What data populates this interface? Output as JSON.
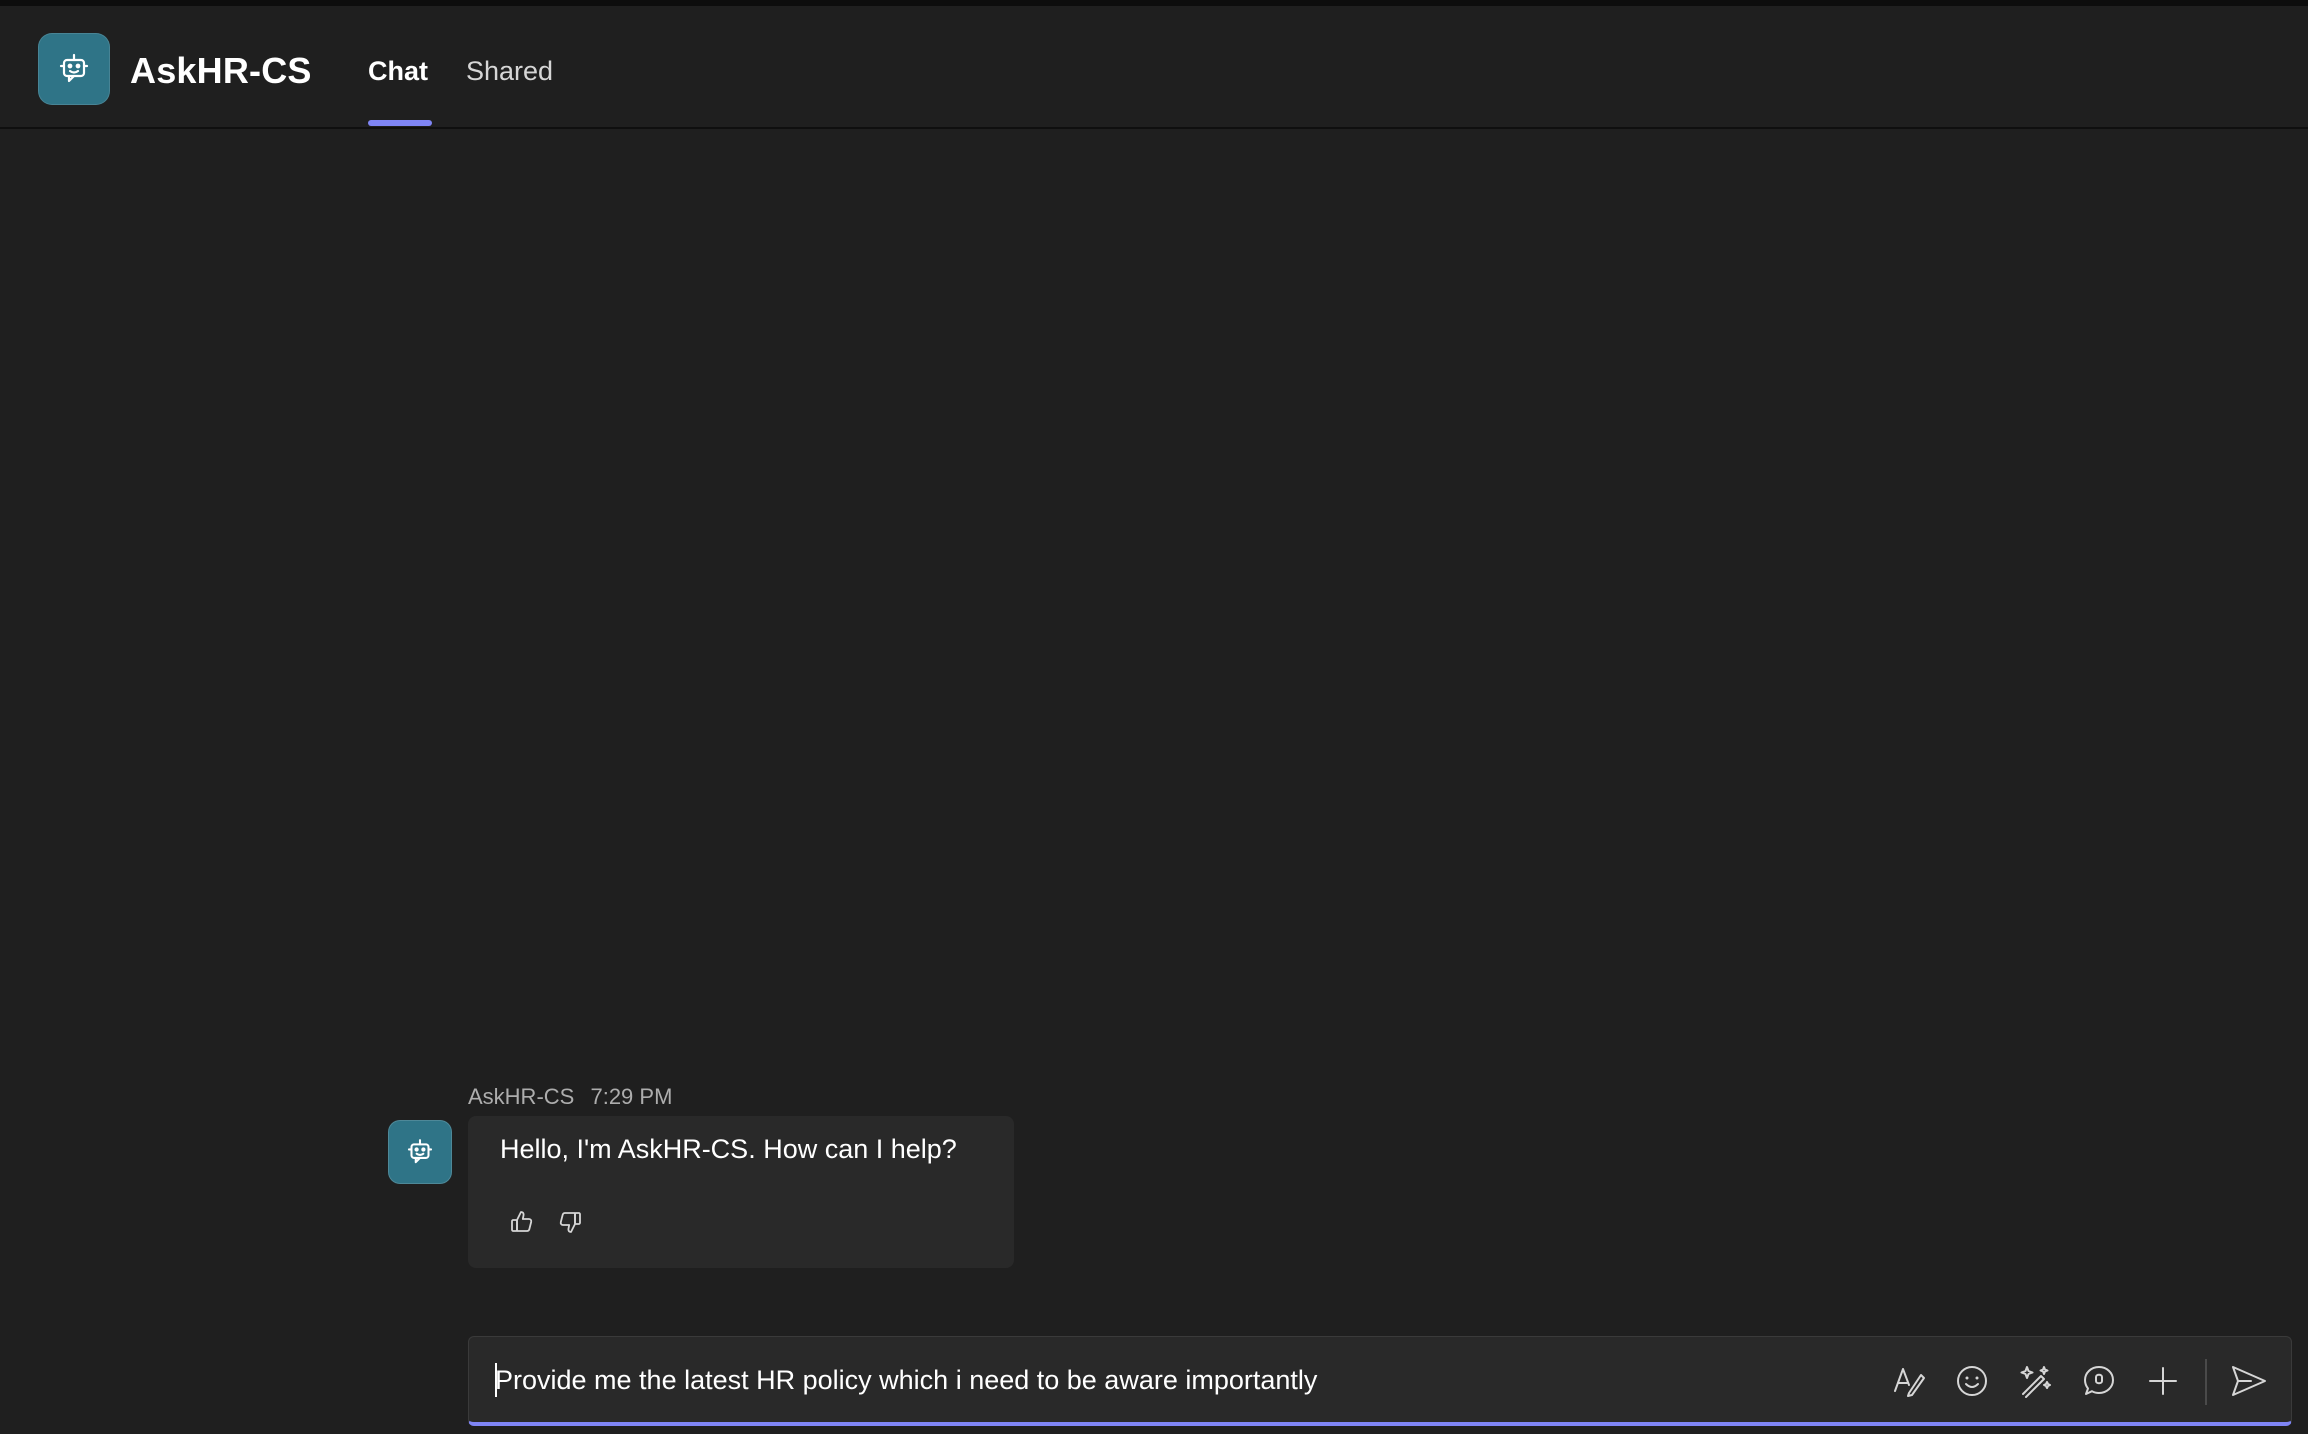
{
  "app": {
    "title": "AskHR-CS",
    "icon": "bot-icon",
    "accent_color": "#7f85f5",
    "icon_bg_color": "#2f7487"
  },
  "tabs": [
    {
      "label": "Chat",
      "active": true
    },
    {
      "label": "Shared",
      "active": false
    }
  ],
  "conversation": {
    "messages": [
      {
        "sender": "AskHR-CS",
        "time": "7:29 PM",
        "text": "Hello, I'm AskHR-CS. How can I help?",
        "reactions": [
          "thumbs-up-icon",
          "thumbs-down-icon"
        ]
      }
    ]
  },
  "composer": {
    "value": "Provide me the latest HR policy which i need to be aware importantly",
    "tools": [
      "format-icon",
      "emoji-icon",
      "copilot-icon",
      "loop-icon",
      "plus-icon",
      "send-icon"
    ]
  }
}
